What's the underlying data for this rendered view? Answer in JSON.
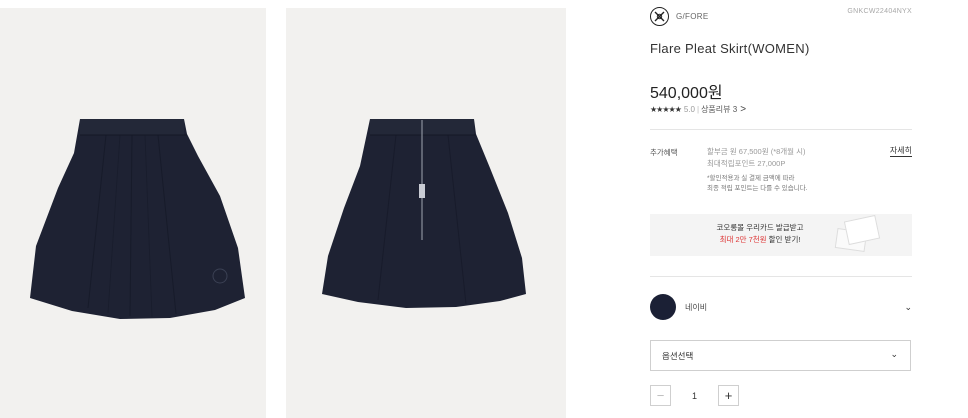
{
  "product": {
    "brand": "G/FORE",
    "sku": "GNKCW22404NYX",
    "title": "Flare Pleat Skirt(WOMEN)",
    "price": "540,000원",
    "rating": "5.0",
    "review_label": "상품리뷰 3",
    "review_arrow": ">"
  },
  "benefits": {
    "label": "추가혜택",
    "installment": "할부금 원 67,500원 (*8개월 시)",
    "points": "최대적립포인트 27,000P",
    "note1": "*할인적용과 실 결제 금액에 따라",
    "note2": "최종 적립 포인트는 다를 수 있습니다.",
    "detail_link": "자세히"
  },
  "banner": {
    "line1": "코오롱몰 우리카드 발급받고",
    "line2_highlight": "최대 2만 7천원",
    "line2_rest": " 할인 받기!"
  },
  "color_option": {
    "name": "네이비",
    "swatch": "#1b2035"
  },
  "option_select": {
    "placeholder": "옵션선택"
  },
  "quantity": {
    "minus": "−",
    "value": "1",
    "plus": "+"
  },
  "icons": {
    "stars": "★★★★★",
    "chevron_down": "⌄"
  },
  "colors": {
    "skirt": "#1e2233",
    "photo_bg": "#f2f1ef",
    "accent_red": "#d33333"
  }
}
